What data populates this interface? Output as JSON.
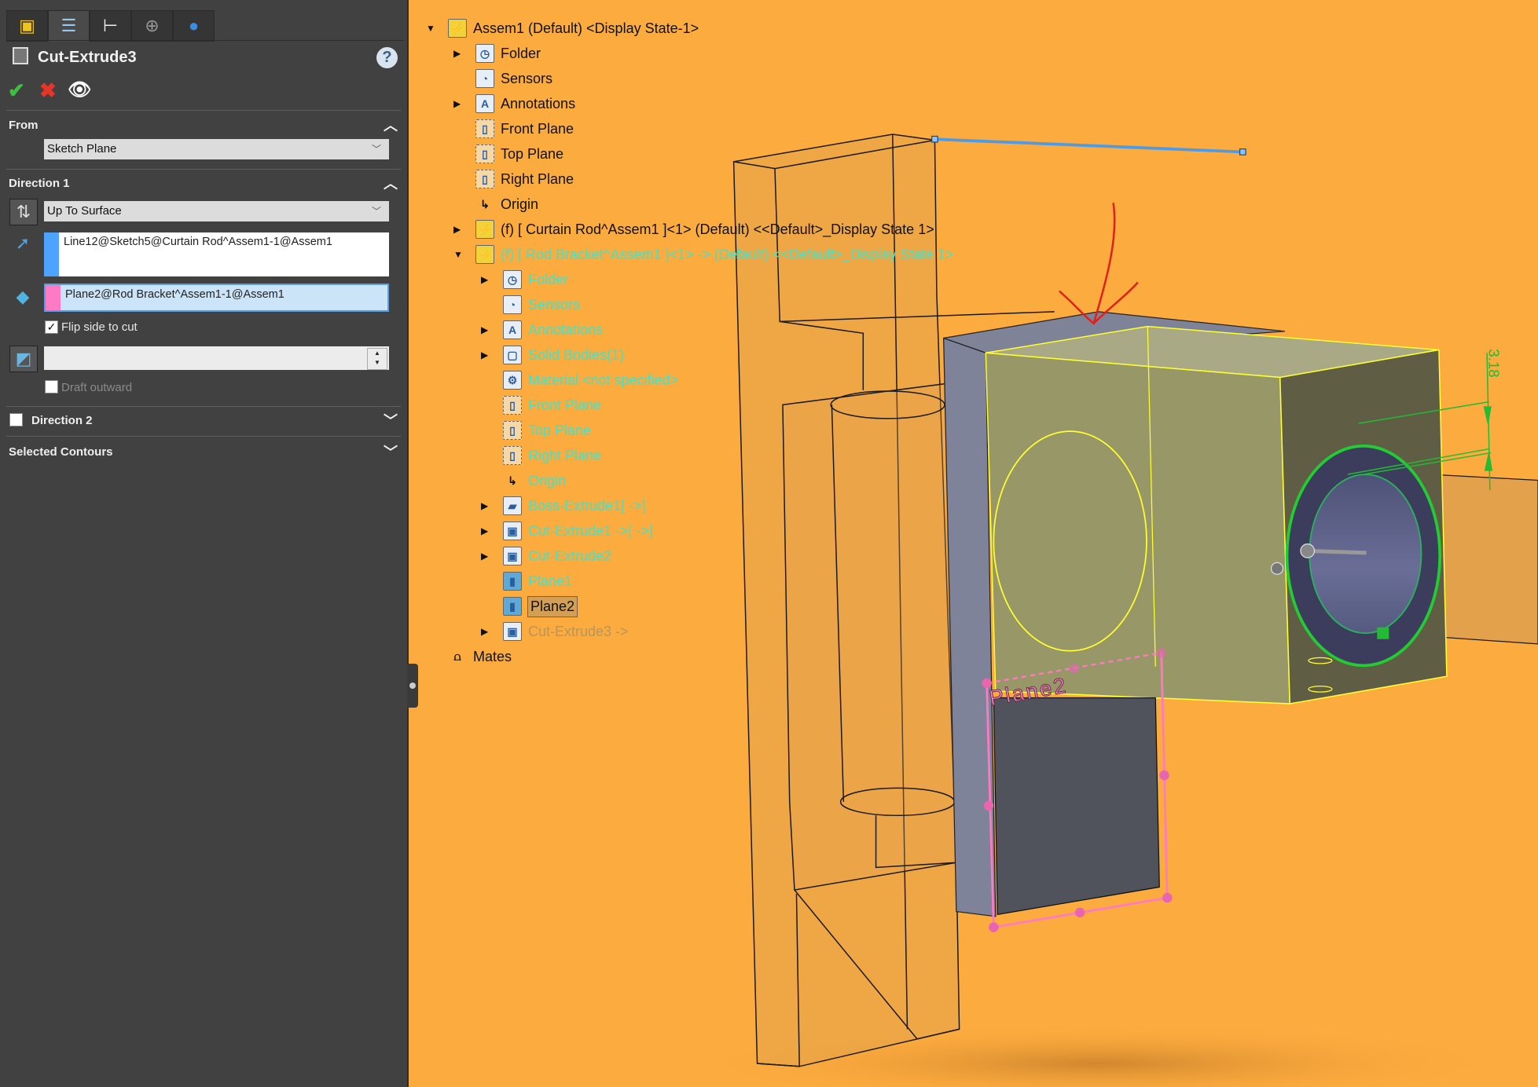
{
  "panel": {
    "tabs": [
      {
        "icon": "feature-manager-icon"
      },
      {
        "icon": "property-manager-icon"
      },
      {
        "icon": "configuration-manager-icon"
      },
      {
        "icon": "dimxpert-manager-icon"
      },
      {
        "icon": "display-manager-icon"
      }
    ],
    "title": "Cut-Extrude3",
    "help": "?",
    "ok": "✔",
    "cancel": "✖",
    "preview": "👁",
    "from": {
      "label": "From",
      "value": "Sketch Plane"
    },
    "direction1": {
      "label": "Direction 1",
      "end_condition": "Up To Surface",
      "direction_ref": "Line12@Sketch5@Curtain Rod^Assem1-1@Assem1",
      "direction_color": "#4da3ff",
      "surface_ref": "Plane2@Rod Bracket^Assem1-1@Assem1",
      "surface_color": "#ff7ac4",
      "flip_side_label": "Flip side to cut",
      "flip_side_checked": true,
      "draft_value": "",
      "draft_outward_label": "Draft outward",
      "draft_outward_checked": false
    },
    "direction2": {
      "label": "Direction 2",
      "checked": false
    },
    "selected_contours": {
      "label": "Selected Contours"
    }
  },
  "tree": [
    {
      "label": "Assem1 (Default) <Display State-1>",
      "level": 0,
      "expander": "open",
      "icon": "assembly-icon",
      "style": "normal"
    },
    {
      "label": "Folder",
      "level": 1,
      "expander": "closed",
      "icon": "history-folder-icon",
      "style": "normal"
    },
    {
      "label": "Sensors",
      "level": 1,
      "expander": "",
      "icon": "sensors-icon",
      "style": "normal"
    },
    {
      "label": "Annotations",
      "level": 1,
      "expander": "closed",
      "icon": "annotations-icon",
      "style": "normal"
    },
    {
      "label": "Front Plane",
      "level": 1,
      "expander": "",
      "icon": "plane-icon",
      "style": "normal"
    },
    {
      "label": "Top Plane",
      "level": 1,
      "expander": "",
      "icon": "plane-icon",
      "style": "normal"
    },
    {
      "label": "Right Plane",
      "level": 1,
      "expander": "",
      "icon": "plane-icon",
      "style": "normal"
    },
    {
      "label": "Origin",
      "level": 1,
      "expander": "",
      "icon": "origin-icon",
      "style": "normal"
    },
    {
      "label": "(f) [ Curtain Rod^Assem1 ]<1> (Default) <<Default>_Display State 1>",
      "level": 1,
      "expander": "closed",
      "icon": "assembly-icon",
      "style": "normal"
    },
    {
      "label": "(f) [ Rod Bracket^Assem1 ]<1> -> (Default) <<Default>_Display State 1>",
      "level": 1,
      "expander": "open",
      "icon": "assembly-icon",
      "style": "cyan"
    },
    {
      "label": "Folder",
      "level": 2,
      "expander": "closed",
      "icon": "history-folder-icon",
      "style": "cyan"
    },
    {
      "label": "Sensors",
      "level": 2,
      "expander": "",
      "icon": "sensors-icon",
      "style": "cyan"
    },
    {
      "label": "Annotations",
      "level": 2,
      "expander": "closed",
      "icon": "annotations-icon",
      "style": "cyan"
    },
    {
      "label": "Solid Bodies(1)",
      "level": 2,
      "expander": "closed",
      "icon": "solid-bodies-icon",
      "style": "cyan"
    },
    {
      "label": "Material <not specified>",
      "level": 2,
      "expander": "",
      "icon": "material-icon",
      "style": "cyan"
    },
    {
      "label": "Front Plane",
      "level": 2,
      "expander": "",
      "icon": "plane-icon",
      "style": "cyan"
    },
    {
      "label": "Top Plane",
      "level": 2,
      "expander": "",
      "icon": "plane-icon",
      "style": "cyan"
    },
    {
      "label": "Right Plane",
      "level": 2,
      "expander": "",
      "icon": "plane-icon",
      "style": "cyan"
    },
    {
      "label": "Origin",
      "level": 2,
      "expander": "",
      "icon": "origin-icon",
      "style": "cyan"
    },
    {
      "label": "Boss-Extrude1[ ->]",
      "level": 2,
      "expander": "closed",
      "icon": "boss-extrude-icon",
      "style": "cyan"
    },
    {
      "label": "Cut-Extrude1 ->[ ->]",
      "level": 2,
      "expander": "closed",
      "icon": "cut-extrude-icon",
      "style": "cyan"
    },
    {
      "label": "Cut-Extrude2",
      "level": 2,
      "expander": "closed",
      "icon": "cut-extrude-icon",
      "style": "cyan"
    },
    {
      "label": "Plane1",
      "level": 2,
      "expander": "",
      "icon": "ref-plane-icon",
      "style": "cyan"
    },
    {
      "label": "Plane2",
      "level": 2,
      "expander": "",
      "icon": "ref-plane-icon",
      "style": "selected"
    },
    {
      "label": "Cut-Extrude3 ->",
      "level": 2,
      "expander": "closed",
      "icon": "cut-extrude-icon",
      "style": "grey"
    },
    {
      "label": "Mates",
      "level": 0,
      "expander": "",
      "icon": "mates-icon",
      "style": "normal"
    }
  ],
  "viewport": {
    "background": "#fcab3e",
    "plane_label": "Plane2",
    "dimension": "3.18"
  }
}
